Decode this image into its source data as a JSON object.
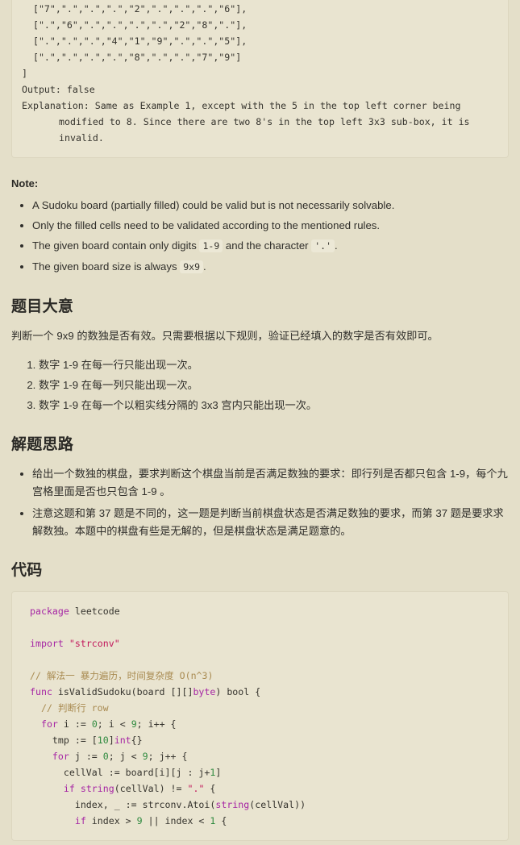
{
  "example_block": {
    "board_rows": [
      "  [\"7\",\".\",\".\",\".\",\"2\",\".\",\".\",\".\",\"6\"],",
      "  [\".\",\"6\",\".\",\".\",\".\",\".\",\"2\",\"8\",\".\"],",
      "  [\".\",\".\",\".\",\"4\",\"1\",\"9\",\".\",\".\",\"5\"],",
      "  [\".\",\".\",\".\",\".\",\"8\",\".\",\".\",\"7\",\"9\"]",
      "]"
    ],
    "output_line": "Output: false",
    "explanation_line": "Explanation: Same as Example 1, except with the 5 in the top left corner being modified to 8. Since there are two 8's in the top left 3x3 sub-box, it is invalid."
  },
  "note": {
    "label": "Note:",
    "items": [
      {
        "before": "A Sudoku board (partially filled) could be valid but is not necessarily solvable.",
        "code1": "",
        "middle": "",
        "code2": "",
        "after": ""
      },
      {
        "before": "Only the filled cells need to be validated according to the mentioned rules.",
        "code1": "",
        "middle": "",
        "code2": "",
        "after": ""
      },
      {
        "before": "The given board contain only digits ",
        "code1": "1-9",
        "middle": " and the character ",
        "code2": "'.'",
        "after": "."
      },
      {
        "before": "The given board size is always ",
        "code1": "9x9",
        "middle": "",
        "code2": "",
        "after": "."
      }
    ]
  },
  "summary": {
    "heading": "题目大意",
    "paragraph": "判断一个 9x9 的数独是否有效。只需要根据以下规则，验证已经填入的数字是否有效即可。",
    "rules": [
      "数字 1-9 在每一行只能出现一次。",
      "数字 1-9 在每一列只能出现一次。",
      "数字 1-9 在每一个以粗实线分隔的 3x3 宫内只能出现一次。"
    ]
  },
  "approach": {
    "heading": "解题思路",
    "items": [
      "给出一个数独的棋盘，要求判断这个棋盘当前是否满足数独的要求：即行列是否都只包含 1-9，每个九宫格里面是否也只包含 1-9 。",
      "注意这题和第 37 题是不同的，这一题是判断当前棋盘状态是否满足数独的要求，而第 37 题是要求求解数独。本题中的棋盘有些是无解的，但是棋盘状态是满足题意的。"
    ]
  },
  "code_section": {
    "heading": "代码",
    "language": "go",
    "lines": [
      "package leetcode",
      "",
      "import \"strconv\"",
      "",
      "// 解法一 暴力遍历，时间复杂度 O(n^3)",
      "func isValidSudoku(board [][]byte) bool {",
      "  // 判断行 row",
      "  for i := 0; i < 9; i++ {",
      "    tmp := [10]int{}",
      "    for j := 0; j < 9; j++ {",
      "      cellVal := board[i][j : j+1]",
      "      if string(cellVal) != \".\" {",
      "        index, _ := strconv.Atoi(string(cellVal))",
      "        if index > 9 || index < 1 {"
    ]
  },
  "colors": {
    "page_background": "#e4dfc9",
    "code_background": "#e9e4d0",
    "inline_code_background": "#ece8d6",
    "text": "#2f2e2a",
    "keyword": "#a626a4",
    "string": "#c2185b",
    "number": "#2f8a3f",
    "comment": "#a98b52"
  }
}
